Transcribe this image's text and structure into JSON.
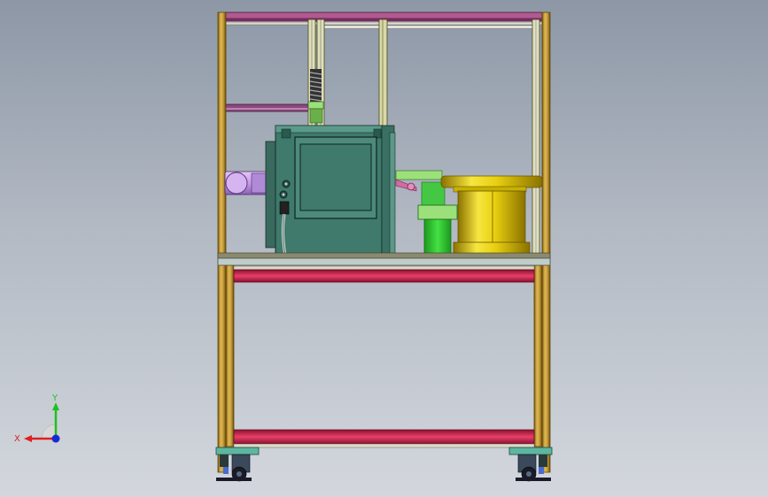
{
  "viewport": {
    "background_top": "#8d97a6",
    "background_bottom": "#d3d7dd"
  },
  "colors": {
    "frame_gold": "#c8a040",
    "frame_gold_dark": "#7a5a10",
    "frame_edge": "#5a4508",
    "top_rail": "#b05a90",
    "tier_rail_red": "#d8305a",
    "tier_rail_red_dark": "#8a1030",
    "rail_light": "#dcdcc8",
    "plate": "#c0ccc8",
    "machine_body": "#3f7a6c",
    "machine_panel": "#4d8a7c",
    "machine_dark": "#1e3a34",
    "motor": "#c89ae8",
    "mount_green": "#33d633",
    "mount_green_light": "#9be07a",
    "spool_gold": "#e8cf10",
    "spool_gold_dark": "#8a7200",
    "link_pink": "#d46aa0",
    "caster_teal": "#5fb6a0",
    "caster_dark": "#1a1a2a"
  },
  "triad": {
    "x_label": "X",
    "y_label": "Y",
    "x_color": "#e02020",
    "y_color": "#20c020",
    "z_color": "#1a2ad0"
  }
}
